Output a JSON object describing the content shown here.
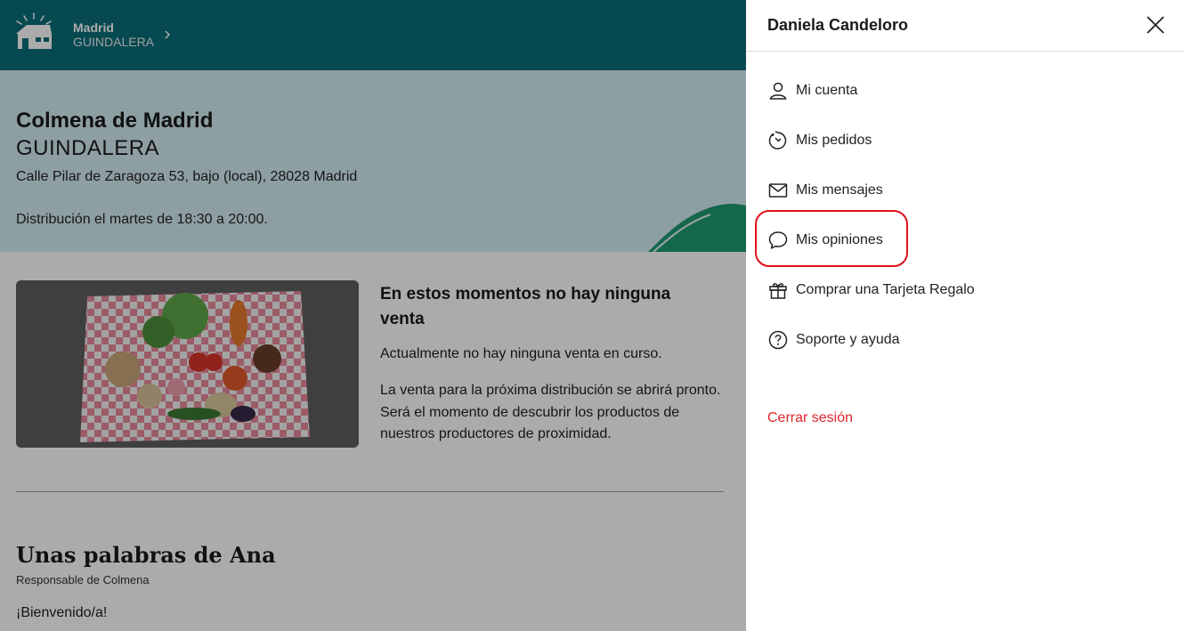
{
  "header": {
    "city": "Madrid",
    "hive_name": "GUINDALERA"
  },
  "hero": {
    "title": "Colmena de Madrid",
    "subtitle": "GUINDALERA",
    "address": "Calle Pilar de Zaragoza 53, bajo (local), 28028 Madrid",
    "distribution": "Distribución el martes de 18:30 a 20:00."
  },
  "sale": {
    "title": "En estos momentos no hay ninguna venta",
    "p1": "Actualmente no hay ninguna venta en curso.",
    "p2": "La venta para la próxima distribución se abrirá pronto. Será el momento de descubrir los productos de nuestros productores de proximidad."
  },
  "words": {
    "title": "Unas palabras de Ana",
    "subtitle": "Responsable de Colmena",
    "welcome": "¡Bienvenido/a!"
  },
  "drawer": {
    "user_name": "Daniela Candeloro",
    "menu": [
      {
        "label": "Mi cuenta",
        "icon": "user-icon"
      },
      {
        "label": "Mis pedidos",
        "icon": "clock-icon"
      },
      {
        "label": "Mis mensajes",
        "icon": "mail-icon"
      },
      {
        "label": "Mis opiniones",
        "icon": "chat-bubble-icon"
      },
      {
        "label": "Comprar una Tarjeta Regalo",
        "icon": "gift-icon"
      },
      {
        "label": "Soporte y ayuda",
        "icon": "help-icon"
      }
    ],
    "logout_label": "Cerrar sesión"
  },
  "colors": {
    "topbar": "#0b6e78",
    "hero_bg": "#d4edf3",
    "accent_green": "#1f9a73",
    "logout_red": "#e0242a",
    "highlight_red": "#e0101a"
  }
}
